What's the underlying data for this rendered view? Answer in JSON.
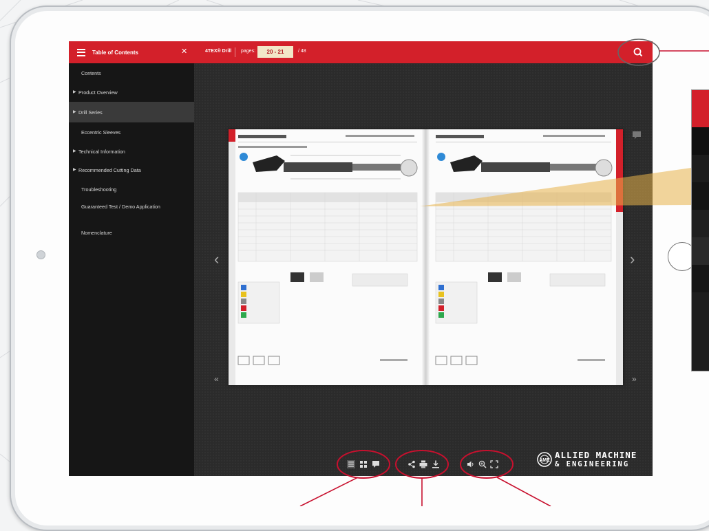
{
  "toc": {
    "title": "Table of Contents",
    "close_symbol": "✕",
    "items": [
      {
        "label": "Contents",
        "has_arrow": false
      },
      {
        "label": "Product Overview",
        "has_arrow": true
      },
      {
        "label": "Drill Series",
        "has_arrow": true,
        "active": true
      },
      {
        "label": "Eccentric Sleeves",
        "has_arrow": false
      },
      {
        "label": "Technical Information",
        "has_arrow": true
      },
      {
        "label": "Recommended Cutting Data",
        "has_arrow": true
      },
      {
        "label": "Troubleshooting",
        "has_arrow": false
      },
      {
        "label": "Guaranteed Test / Demo Application",
        "has_arrow": false
      },
      {
        "label": "Nomenclature",
        "has_arrow": false
      }
    ]
  },
  "header": {
    "doc_title": "4TEX® Drill",
    "pages_label": "pages:",
    "pages_value": "20 - 21",
    "pages_total": "/ 48"
  },
  "toolbar": {
    "groups": [
      [
        "list-view-icon",
        "thumbnails-icon",
        "comment-icon"
      ],
      [
        "share-icon",
        "print-icon",
        "download-icon"
      ],
      [
        "sound-icon",
        "zoom-icon",
        "fullscreen-icon"
      ]
    ]
  },
  "logo": {
    "line1": "ALLIED MACHINE",
    "line2": "& ENGINEERING"
  },
  "colors": {
    "brand_red": "#d3202a",
    "sidebar_bg": "#161616",
    "annotation_red": "#c8102e"
  }
}
